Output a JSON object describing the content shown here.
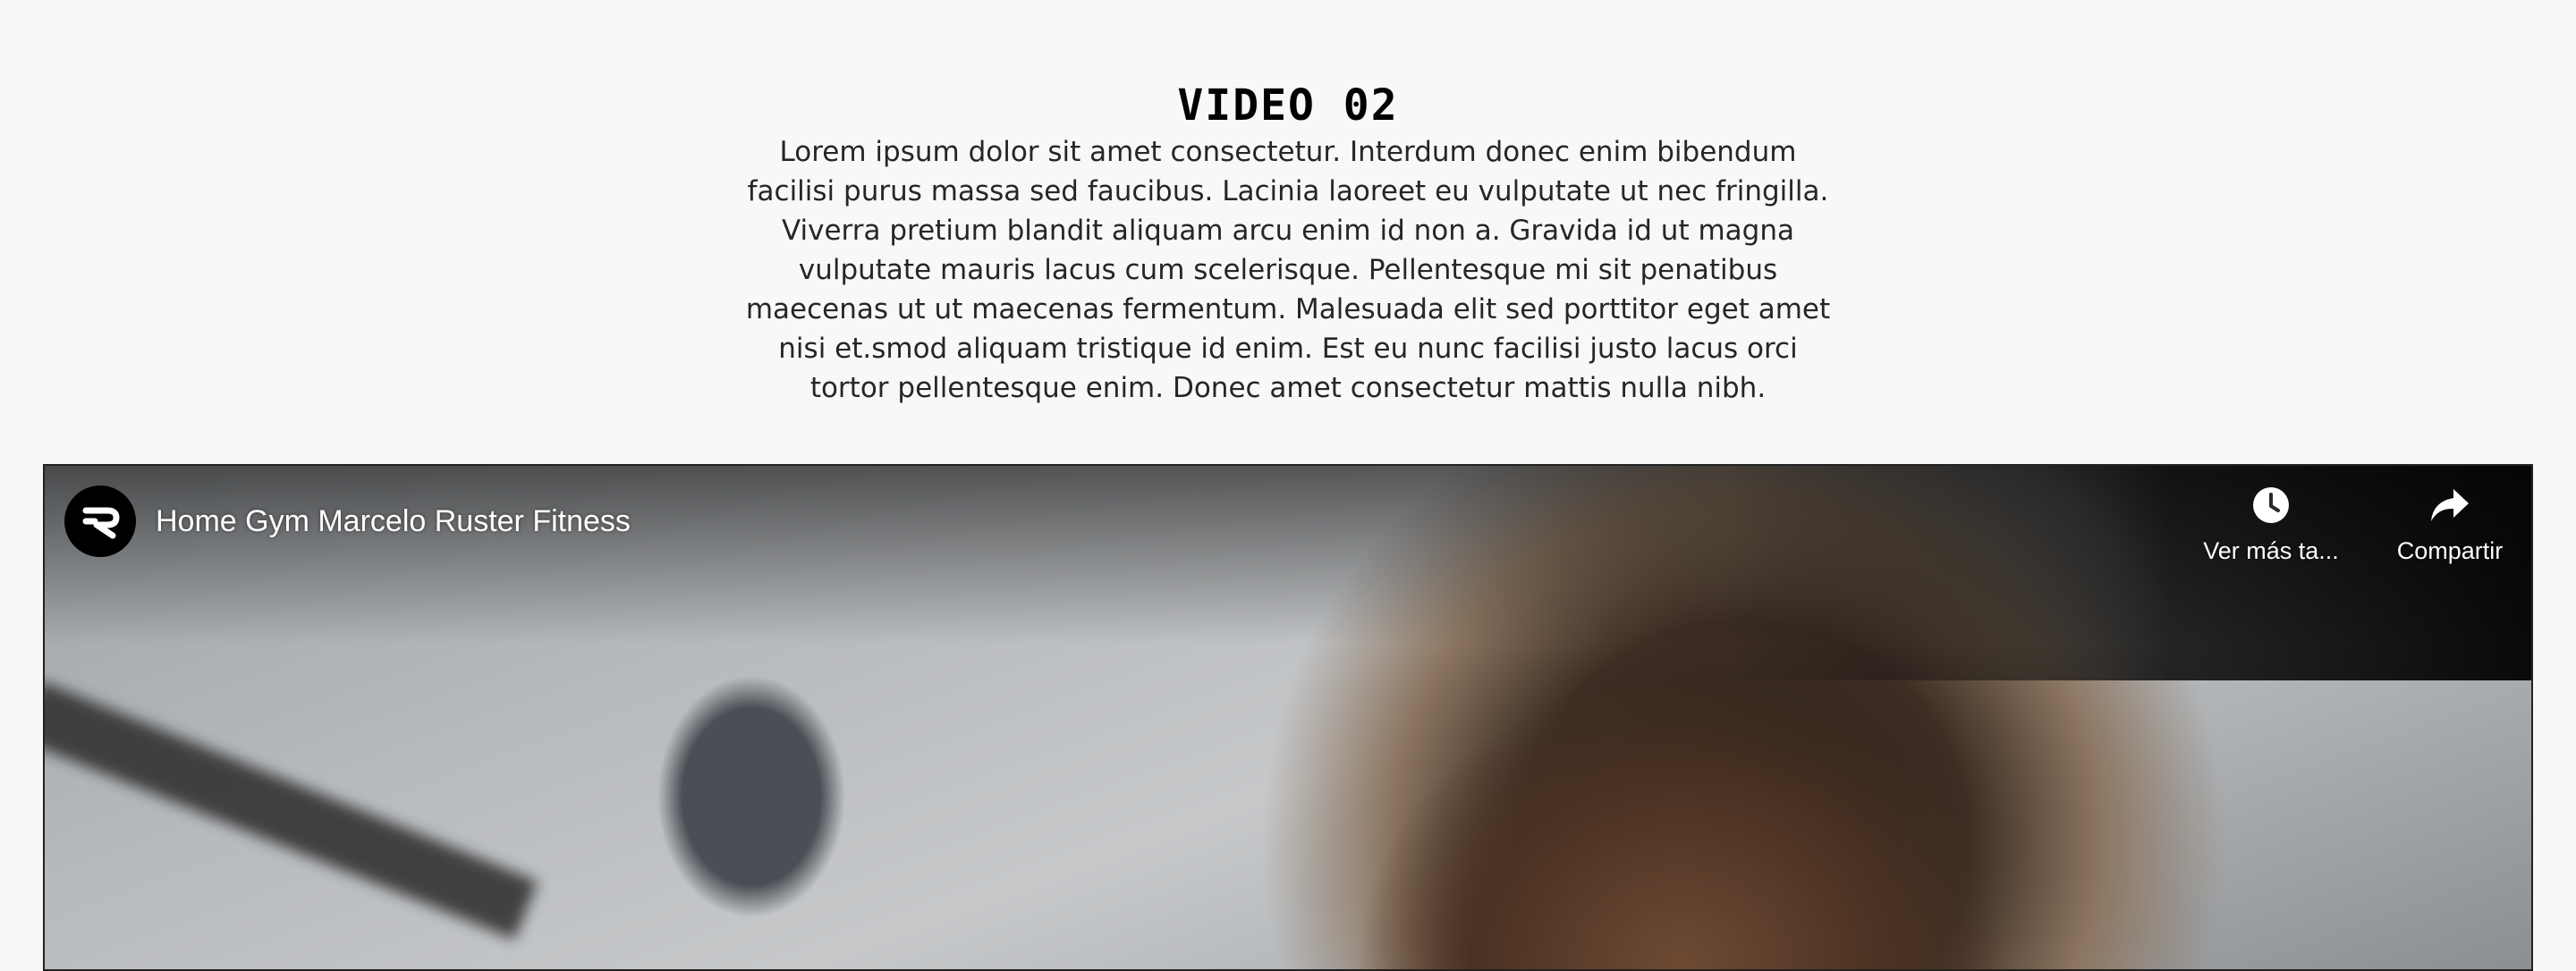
{
  "section": {
    "title": "VIDEO 02",
    "description": "Lorem ipsum dolor sit amet consectetur. Interdum donec enim bibendum facilisi purus massa sed faucibus. Lacinia laoreet eu vulputate ut nec fringilla. Viverra pretium blandit aliquam arcu enim id non a. Gravida id ut magna vulputate mauris lacus cum scelerisque. Pellentesque mi sit penatibus maecenas ut ut maecenas fermentum. Malesuada elit sed porttitor eget amet nisi et.smod aliquam tristique id enim. Est eu nunc facilisi justo lacus orci tortor pellentesque enim. Donec amet consectetur mattis nulla nibh."
  },
  "video": {
    "title": "Home Gym Marcelo Ruster Fitness",
    "channel_avatar_icon": "channel-logo-icon",
    "actions": {
      "watch_later_label": "Ver más ta...",
      "watch_later_icon": "clock-icon",
      "share_label": "Compartir",
      "share_icon": "share-arrow-icon"
    }
  },
  "colors": {
    "background": "#f8f8f8",
    "title_text": "#000000",
    "body_text": "#262626",
    "overlay_text": "#ffffff"
  }
}
